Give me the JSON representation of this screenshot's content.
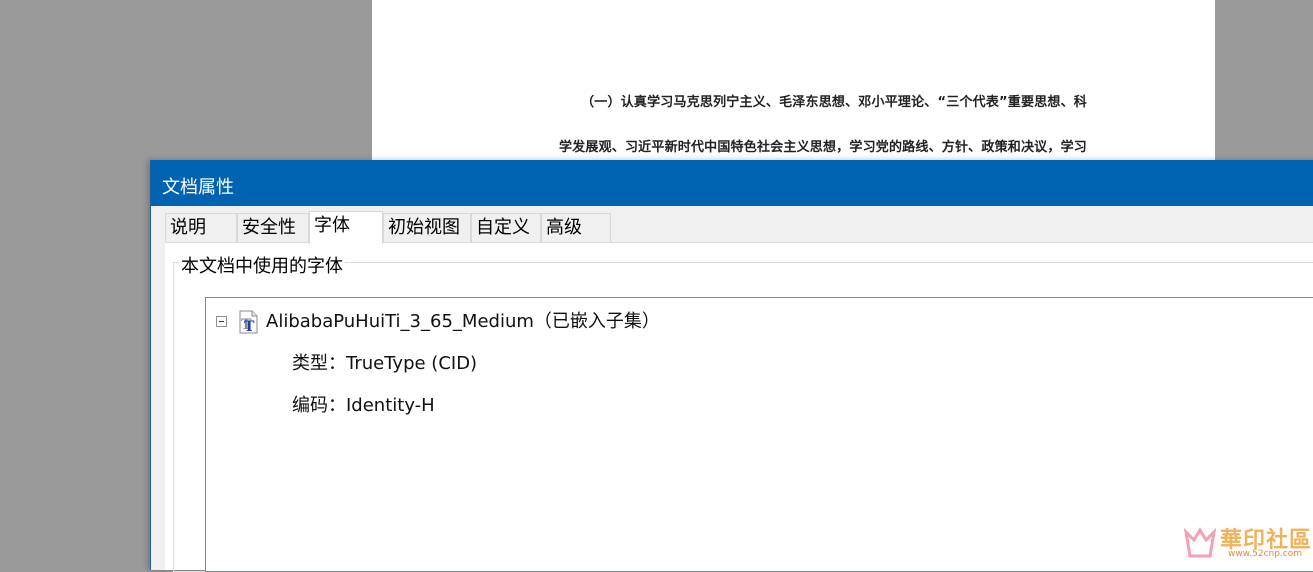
{
  "document": {
    "line1": "（一）认真学习马克思列宁主义、毛泽东思想、邓小平理论、“三个代表”重要思想、科",
    "line2": "学发展观、习近平新时代中国特色社会主义思想，学习党的路线、方针、政策和决议，学习"
  },
  "dialog": {
    "title": "文档属性",
    "tabs": [
      {
        "label": "说明",
        "active": false
      },
      {
        "label": "安全性",
        "active": false
      },
      {
        "label": "字体",
        "active": true
      },
      {
        "label": "初始视图",
        "active": false
      },
      {
        "label": "自定义",
        "active": false
      },
      {
        "label": "高级",
        "active": false
      }
    ],
    "fonts_panel": {
      "group_label": "本文档中使用的字体",
      "fonts": [
        {
          "name": "AlibabaPuHuiTi_3_65_Medium（已嵌入子集）",
          "icon": "truetype-font-icon",
          "type_line": "类型：TrueType (CID)",
          "encoding_line": "编码：Identity-H"
        }
      ]
    }
  },
  "colors": {
    "titlebar": "#0063b1",
    "background": "#9a9a9a"
  },
  "watermark": {
    "text": "華印社區",
    "url": "www.52cnp.com"
  }
}
